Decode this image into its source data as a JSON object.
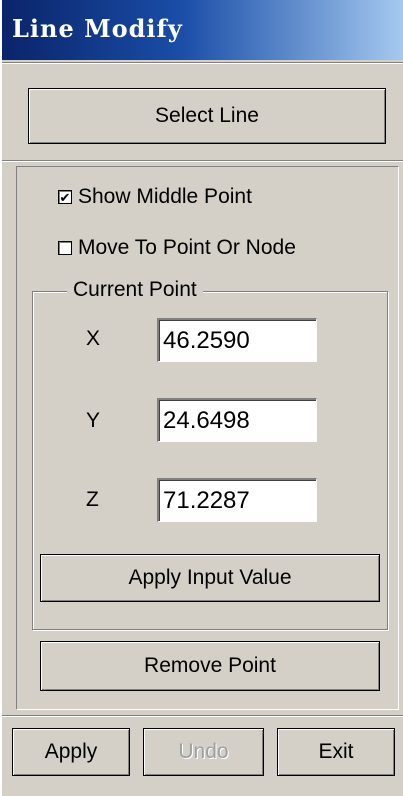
{
  "window": {
    "title": "Line Modify"
  },
  "select_line_button": "Select Line",
  "options": {
    "show_middle_point": {
      "label": "Show Middle Point",
      "checked": true,
      "mark": "✔"
    },
    "move_to_point": {
      "label": "Move To Point Or Node",
      "checked": false,
      "mark": ""
    }
  },
  "current_point": {
    "legend": "Current Point",
    "x_label": "X",
    "x_value": "46.2590",
    "y_label": "Y",
    "y_value": "24.6498",
    "z_label": "Z",
    "z_value": "71.2287",
    "apply_input_button": "Apply Input Value"
  },
  "remove_point_button": "Remove Point",
  "footer": {
    "apply": "Apply",
    "undo": "Undo",
    "exit": "Exit",
    "undo_enabled": false
  }
}
